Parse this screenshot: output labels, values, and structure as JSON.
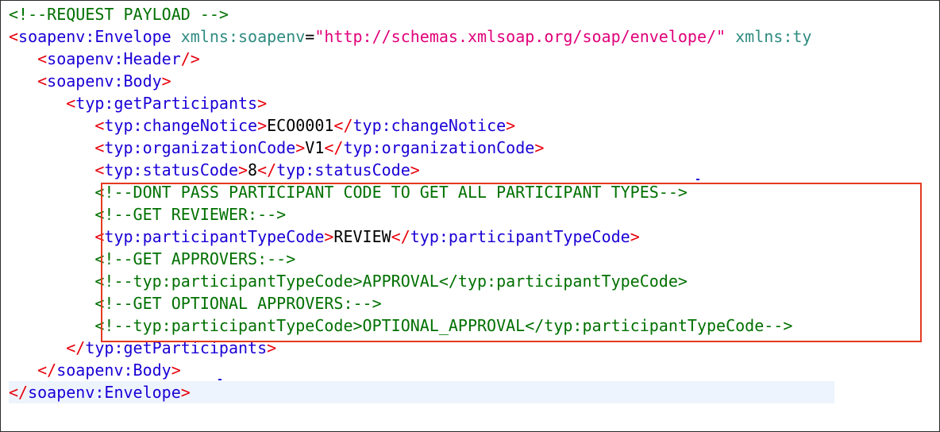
{
  "lines": [
    {
      "indent": "",
      "parts": [
        {
          "cls": "c",
          "text": "<!--REQUEST PAYLOAD -->"
        }
      ]
    },
    {
      "indent": "",
      "parts": [
        {
          "cls": "p",
          "text": "<"
        },
        {
          "cls": "t",
          "text": "soapenv:Envelope"
        },
        {
          "cls": "a",
          "text": " xmlns:soapenv"
        },
        {
          "cls": "x",
          "text": "="
        },
        {
          "cls": "v",
          "text": "\"http://schemas.xmlsoap.org/soap/envelope/\""
        },
        {
          "cls": "a",
          "text": " xmlns:ty"
        }
      ]
    },
    {
      "indent": "   ",
      "parts": [
        {
          "cls": "p",
          "text": "<"
        },
        {
          "cls": "t",
          "text": "soapenv:Header"
        },
        {
          "cls": "p",
          "text": "/>"
        }
      ]
    },
    {
      "indent": "   ",
      "parts": [
        {
          "cls": "p",
          "text": "<"
        },
        {
          "cls": "t",
          "text": "soapenv:Body"
        },
        {
          "cls": "p",
          "text": ">"
        }
      ]
    },
    {
      "indent": "      ",
      "parts": [
        {
          "cls": "p",
          "text": "<"
        },
        {
          "cls": "t",
          "text": "typ:getParticipants"
        },
        {
          "cls": "p",
          "text": ">"
        }
      ]
    },
    {
      "indent": "         ",
      "parts": [
        {
          "cls": "p",
          "text": "<"
        },
        {
          "cls": "t",
          "text": "typ:changeNotice"
        },
        {
          "cls": "p",
          "text": ">"
        },
        {
          "cls": "x",
          "text": "ECO0001"
        },
        {
          "cls": "p",
          "text": "</"
        },
        {
          "cls": "t",
          "text": "typ:changeNotice"
        },
        {
          "cls": "p",
          "text": ">"
        }
      ]
    },
    {
      "indent": "         ",
      "parts": [
        {
          "cls": "p",
          "text": "<"
        },
        {
          "cls": "t",
          "text": "typ:organizationCode"
        },
        {
          "cls": "p",
          "text": ">"
        },
        {
          "cls": "x",
          "text": "V1"
        },
        {
          "cls": "p",
          "text": "</"
        },
        {
          "cls": "t",
          "text": "typ:organizationCode"
        },
        {
          "cls": "p",
          "text": ">"
        }
      ]
    },
    {
      "indent": "         ",
      "parts": [
        {
          "cls": "p",
          "text": "<"
        },
        {
          "cls": "t",
          "text": "typ:statusCode"
        },
        {
          "cls": "p",
          "text": ">"
        },
        {
          "cls": "x",
          "text": "8"
        },
        {
          "cls": "p",
          "text": "</"
        },
        {
          "cls": "t",
          "text": "typ:statusCode"
        },
        {
          "cls": "p",
          "text": ">"
        }
      ]
    },
    {
      "indent": "         ",
      "parts": [
        {
          "cls": "c",
          "text": "<!--DONT PASS PARTICIPANT CODE TO GET ALL PARTICIPANT TYPES-->"
        }
      ]
    },
    {
      "indent": "         ",
      "parts": [
        {
          "cls": "c",
          "text": "<!--GET REVIEWER:-->"
        }
      ]
    },
    {
      "indent": "         ",
      "parts": [
        {
          "cls": "p",
          "text": "<"
        },
        {
          "cls": "t",
          "text": "typ:participantTypeCode"
        },
        {
          "cls": "p",
          "text": ">"
        },
        {
          "cls": "x",
          "text": "REVIEW"
        },
        {
          "cls": "p",
          "text": "</"
        },
        {
          "cls": "t",
          "text": "typ:participantTypeCode"
        },
        {
          "cls": "p",
          "text": ">"
        }
      ]
    },
    {
      "indent": "         ",
      "parts": [
        {
          "cls": "c",
          "text": "<!--GET APPROVERS:-->"
        }
      ]
    },
    {
      "indent": "         ",
      "parts": [
        {
          "cls": "c",
          "text": "<!--typ:participantTypeCode>APPROVAL</typ:participantTypeCode>"
        }
      ]
    },
    {
      "indent": "         ",
      "parts": [
        {
          "cls": "c",
          "text": "<!--GET OPTIONAL APPROVERS:-->"
        }
      ]
    },
    {
      "indent": "         ",
      "parts": [
        {
          "cls": "c",
          "text": "<!--typ:participantTypeCode>OPTIONAL_APPROVAL</typ:participantTypeCode-->"
        }
      ]
    },
    {
      "indent": "      ",
      "parts": [
        {
          "cls": "p",
          "text": "</"
        },
        {
          "cls": "t",
          "text": "typ:getParticipants"
        },
        {
          "cls": "p",
          "text": ">"
        }
      ]
    },
    {
      "indent": "   ",
      "parts": [
        {
          "cls": "p",
          "text": "</"
        },
        {
          "cls": "t",
          "text": "soapenv:Body"
        },
        {
          "cls": "p",
          "text": ">"
        }
      ]
    },
    {
      "indent": "",
      "highlighted": true,
      "parts": [
        {
          "cls": "p",
          "text": "</"
        },
        {
          "cls": "t",
          "text": "soapenv:Envelope"
        },
        {
          "cls": "p",
          "text": ">"
        }
      ]
    }
  ],
  "highlight_box_color": "#e53a1f",
  "colors": {
    "comment": "#007000",
    "punctuation": "#e8000b",
    "tag": "#1a00d6",
    "attribute": "#2e8b80",
    "attribute_value": "#e0007a",
    "text": "#000000"
  }
}
